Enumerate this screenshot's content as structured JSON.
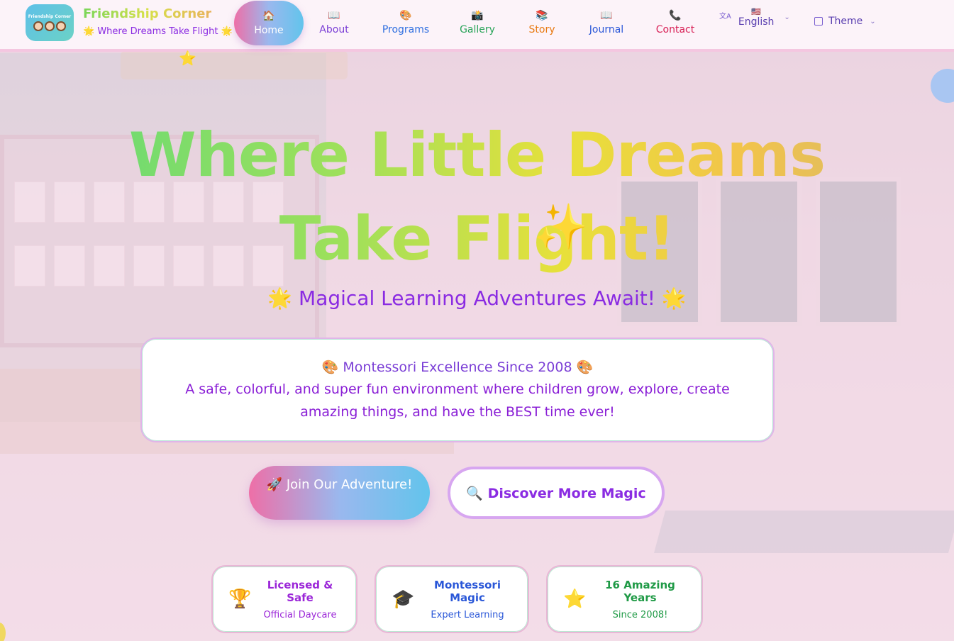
{
  "brand": {
    "title": "Friendship Corner",
    "subtitle": "🌟 Where Dreams Take Flight 🌟",
    "logo_text": "Friendship Corner"
  },
  "nav": {
    "items": [
      {
        "icon": "🏠",
        "label": "Home"
      },
      {
        "icon": "📖",
        "label": "About"
      },
      {
        "icon": "🎨",
        "label": "Programs"
      },
      {
        "icon": "📸",
        "label": "Gallery"
      },
      {
        "icon": "📚",
        "label": "Story"
      },
      {
        "icon": "📖",
        "label": "Journal"
      },
      {
        "icon": "📞",
        "label": "Contact"
      }
    ],
    "language": {
      "flag": "🇺🇸",
      "label": "English",
      "icon": "translate-icon"
    },
    "theme": {
      "label": "Theme",
      "icon": "palette-icon"
    }
  },
  "hero": {
    "title": "Where Little Dreams Take Flight!",
    "sparkle": "✨",
    "subtitle": "🌟 Magical Learning Adventures Await! 🌟",
    "card_heading": "🎨 Montessori Excellence Since 2008 🎨",
    "card_text": "A safe, colorful, and super fun environment where children grow, explore, create amazing things, and have the BEST time ever!",
    "primary_button": "🚀 Join Our Adventure!",
    "secondary_button": "🔍 Discover More Magic"
  },
  "badges": [
    {
      "icon": "🏆",
      "title": "Licensed & Safe",
      "subtitle": "Official Daycare"
    },
    {
      "icon": "🎓",
      "title": "Montessori Magic",
      "subtitle": "Expert Learning"
    },
    {
      "icon": "⭐",
      "title": "16 Amazing Years",
      "subtitle": "Since 2008!"
    }
  ],
  "colors": {
    "accent_purple": "#8a2be2",
    "home_gradient": [
      "#ee6fa7",
      "#62c4ec"
    ],
    "title_gradient": [
      "#63d977",
      "#e8e03a",
      "#d9b96a"
    ]
  }
}
